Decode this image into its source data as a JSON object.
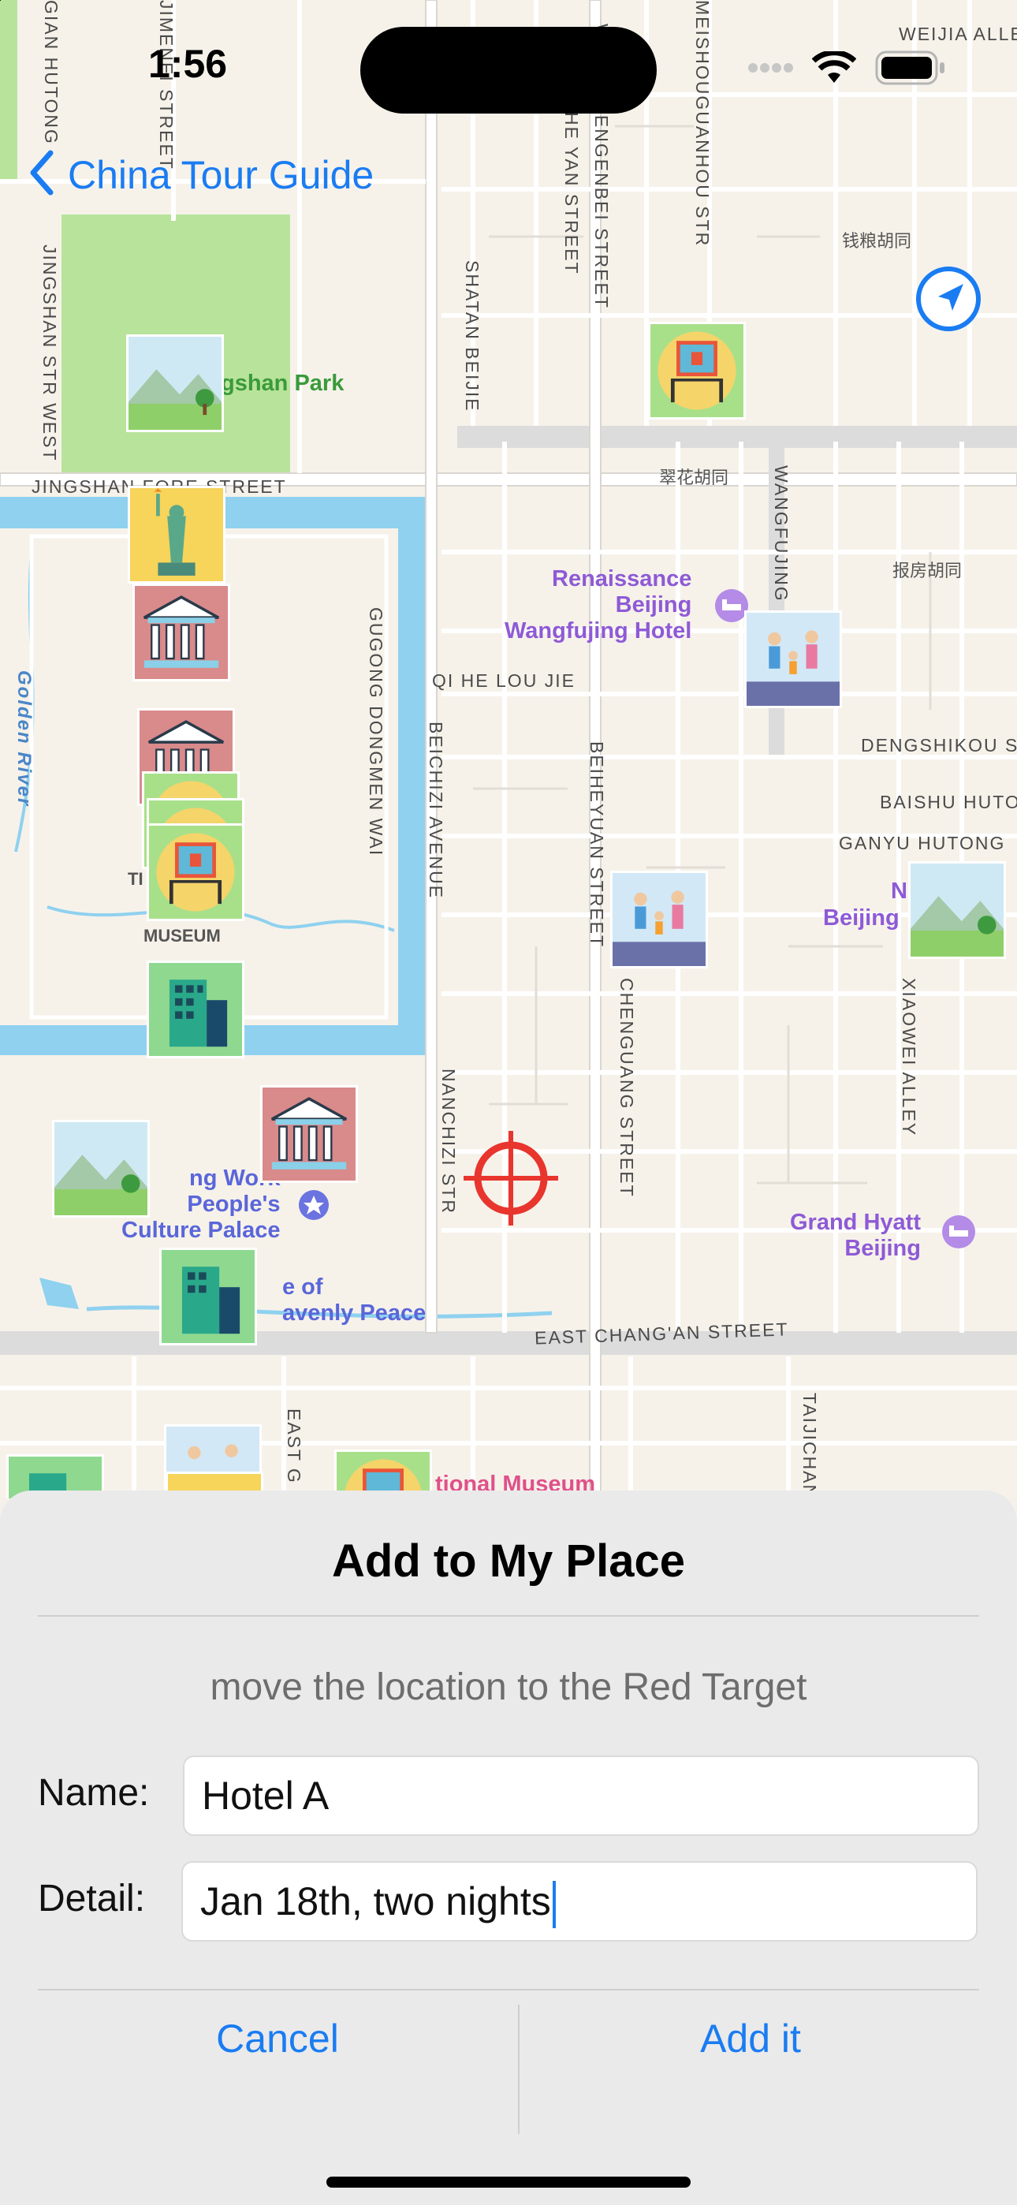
{
  "status": {
    "time": "1:56"
  },
  "nav": {
    "back_label": "China Tour Guide"
  },
  "map": {
    "streets": [
      "JINGSHAN FORE STREET",
      "JINGSHAN STR WEST",
      "SHATAN BEIJIE",
      "QI HE LOU JIE",
      "BEICHIZI AVENUE",
      "GUGONG DONGMEN WAI",
      "BEIHEYUAN STREET",
      "CHENGUANG STREET",
      "NANCHIZI STR",
      "EAST CHANG'AN STREET",
      "WANGFUJING",
      "DENGSHIKOU STR",
      "BAISHU HUTONG",
      "GANYU HUTONG",
      "XIAOWEI ALLEY",
      "TAIJICHANG",
      "EAST G",
      "MEISHOUGUANHOU STR",
      "HE YAN STREET",
      "WANGCHENGENBEI STREET",
      "GIAN HUTONG",
      "JIMENEI STREET",
      "WEIJIA ALLEY"
    ],
    "cn_labels": [
      "钱粮胡同",
      "翠花胡同",
      "报房胡同"
    ],
    "river": "Golden River",
    "pois": {
      "park": "gshan Park",
      "renaissance": "Renaissance\nBeijing\nWangfujing Hotel",
      "museum": "MUSEUM",
      "museum_prefix": "TI",
      "workers": "ng Work\nPeople's\nCulture Palace",
      "heavenly": "e of\navenly Peace",
      "grand_hyatt": "Grand Hyatt\nBeijing",
      "beijing_n": "Beijing",
      "n_letter": "N",
      "national_museum": "tional Museum"
    }
  },
  "dialog": {
    "title": "Add to My Place",
    "hint": "move the location to the Red Target",
    "name_label": "Name:",
    "name_value": "Hotel A",
    "detail_label": "Detail:",
    "detail_value": "Jan 18th, two nights",
    "cancel_label": "Cancel",
    "add_label": "Add it"
  },
  "colors": {
    "accent": "#1a7cf2",
    "target": "#e8352e",
    "water": "#8fd1ef",
    "park": "#b8e39b"
  }
}
